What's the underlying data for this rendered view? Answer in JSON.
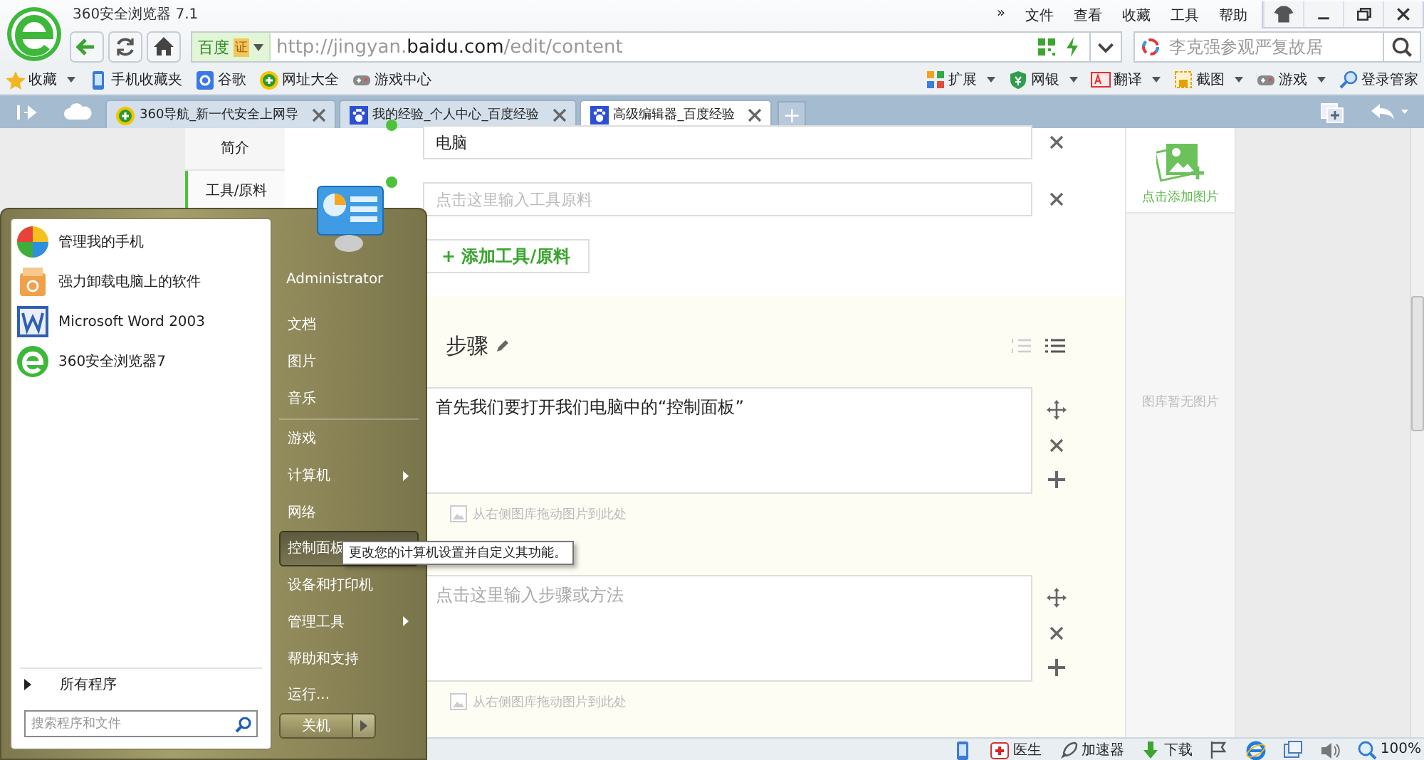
{
  "browser": {
    "title": "360安全浏览器 7.1",
    "menu": [
      {
        "label": "»"
      },
      {
        "label": "文件"
      },
      {
        "label": "查看"
      },
      {
        "label": "收藏"
      },
      {
        "label": "工具"
      },
      {
        "label": "帮助"
      }
    ],
    "address": {
      "site_badge": "百度",
      "cert": "证",
      "url_prefix": "http://jingyan.",
      "url_domain": "baidu.com",
      "url_path": "/edit/content"
    },
    "search": {
      "placeholder": "李克强参观严复故居"
    },
    "bookmarks": [
      {
        "label": "收藏",
        "kind": "star",
        "dropdown": true
      },
      {
        "label": "手机收藏夹",
        "kind": "phone",
        "dropdown": false
      },
      {
        "label": "谷歌",
        "kind": "g",
        "dropdown": false
      },
      {
        "label": "网址大全",
        "kind": "plus",
        "dropdown": false
      },
      {
        "label": "游戏中心",
        "kind": "pad",
        "dropdown": false
      }
    ],
    "tools": [
      {
        "label": "扩展",
        "kind": "grid",
        "dropdown": true
      },
      {
        "label": "网银",
        "kind": "shield",
        "dropdown": true
      },
      {
        "label": "翻译",
        "kind": "aa",
        "dropdown": true
      },
      {
        "label": "截图",
        "kind": "crop",
        "dropdown": true
      },
      {
        "label": "游戏",
        "kind": "pad",
        "dropdown": true
      },
      {
        "label": "登录管家",
        "kind": "key",
        "dropdown": false
      }
    ],
    "tabs": [
      {
        "label": "360导航_新一代安全上网导",
        "kind": "plus",
        "selected": false
      },
      {
        "label": "我的经验_个人中心_百度经验",
        "kind": "paw",
        "selected": false
      },
      {
        "label": "高级编辑器_百度经验",
        "kind": "paw",
        "selected": true
      }
    ],
    "new_tab": "+"
  },
  "editor": {
    "side_nav": [
      {
        "label": "简介",
        "selected": false
      },
      {
        "label": "工具/原料",
        "selected": true
      }
    ],
    "tools": [
      {
        "value": "电脑"
      },
      {
        "placeholder": "点击这里输入工具原料"
      }
    ],
    "add_tool": "+ 添加工具/原料",
    "steps_heading": "步骤",
    "steps": [
      {
        "value": "首先我们要打开我们电脑中的“控制面板”",
        "hint": "从右侧图库拖动图片到此处"
      },
      {
        "placeholder": "点击这里输入步骤或方法",
        "hint": "从右侧图库拖动图片到此处"
      }
    ]
  },
  "gallery": {
    "add": "点击添加图片",
    "empty": "图库暂无图片"
  },
  "status_bar": [
    {
      "kind": "phone"
    },
    {
      "label": "医生",
      "kind": "doctor"
    },
    {
      "label": "加速器",
      "kind": "rocket"
    },
    {
      "label": "下载",
      "kind": "download"
    },
    {
      "kind": "flag"
    },
    {
      "kind": "ie"
    },
    {
      "kind": "window"
    },
    {
      "kind": "speaker"
    },
    {
      "label": "100%",
      "kind": "zoom"
    }
  ],
  "start_menu": {
    "user": "Administrator",
    "programs": [
      {
        "label": "管理我的手机",
        "kind": "pinwheel"
      },
      {
        "label": "强力卸载电脑上的软件",
        "kind": "box"
      },
      {
        "label": "Microsoft Word 2003",
        "kind": "word"
      },
      {
        "label": "360安全浏览器7",
        "kind": "browser"
      }
    ],
    "all_programs": "所有程序",
    "search_placeholder": "搜索程序和文件",
    "places": [
      {
        "label": "文档",
        "submenu": false,
        "selected": false,
        "separator": false
      },
      {
        "label": "图片",
        "submenu": false,
        "selected": false,
        "separator": false
      },
      {
        "label": "音乐",
        "submenu": false,
        "selected": false,
        "separator": true
      },
      {
        "label": "游戏",
        "submenu": false,
        "selected": false,
        "separator": false
      },
      {
        "label": "计算机",
        "submenu": true,
        "selected": false,
        "separator": false
      },
      {
        "label": "网络",
        "submenu": false,
        "selected": false,
        "separator": false
      },
      {
        "label": "控制面板",
        "submenu": false,
        "selected": true,
        "separator": false
      },
      {
        "label": "设备和打印机",
        "submenu": false,
        "selected": false,
        "separator": false
      },
      {
        "label": "管理工具",
        "submenu": true,
        "selected": false,
        "separator": false
      },
      {
        "label": "帮助和支持",
        "submenu": false,
        "selected": false,
        "separator": false
      },
      {
        "label": "运行...",
        "submenu": false,
        "selected": false,
        "separator": false
      }
    ],
    "shutdown": "关机",
    "tooltip": "更改您的计算机设置并自定义其功能。"
  }
}
